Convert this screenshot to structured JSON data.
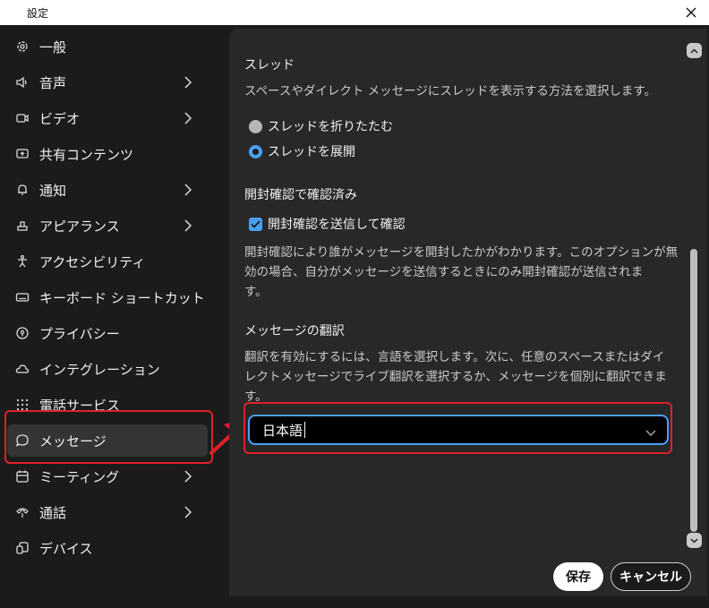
{
  "window": {
    "title": "設定"
  },
  "sidebar": {
    "items": [
      {
        "label": "一般",
        "icon": "gear-icon",
        "has_submenu": false
      },
      {
        "label": "音声",
        "icon": "speaker-icon",
        "has_submenu": true
      },
      {
        "label": "ビデオ",
        "icon": "video-camera-icon",
        "has_submenu": true
      },
      {
        "label": "共有コンテンツ",
        "icon": "screen-share-icon",
        "has_submenu": false
      },
      {
        "label": "通知",
        "icon": "bell-icon",
        "has_submenu": true
      },
      {
        "label": "アピアランス",
        "icon": "paint-brush-icon",
        "has_submenu": true
      },
      {
        "label": "アクセシビリティ",
        "icon": "accessibility-icon",
        "has_submenu": false
      },
      {
        "label": "キーボード ショートカット",
        "icon": "keyboard-icon",
        "has_submenu": false
      },
      {
        "label": "プライバシー",
        "icon": "privacy-icon",
        "has_submenu": false
      },
      {
        "label": "インテグレーション",
        "icon": "cloud-icon",
        "has_submenu": false
      },
      {
        "label": "電話サービス",
        "icon": "dialpad-icon",
        "has_submenu": false
      },
      {
        "label": "メッセージ",
        "icon": "chat-bubble-icon",
        "has_submenu": false,
        "active": true
      },
      {
        "label": "ミーティング",
        "icon": "calendar-icon",
        "has_submenu": true
      },
      {
        "label": "通話",
        "icon": "phone-icon",
        "has_submenu": true
      },
      {
        "label": "デバイス",
        "icon": "devices-icon",
        "has_submenu": false
      }
    ]
  },
  "content": {
    "threads": {
      "title": "スレッド",
      "description": "スペースやダイレクト メッセージにスレッドを表示する方法を選択します。",
      "options": [
        {
          "label": "スレッドを折りたたむ",
          "selected": false
        },
        {
          "label": "スレッドを展開",
          "selected": true
        }
      ]
    },
    "read_receipts": {
      "title": "開封確認で確認済み",
      "checkbox_label": "開封確認を送信して確認",
      "checked": true,
      "description_lines": [
        "開封確認により誰がメッセージを開封したかがわかります。このオプションが無",
        "効の場合、自分がメッセージを送信するときにのみ開封確認が送信されま",
        "す。"
      ]
    },
    "translation": {
      "title": "メッセージの翻訳",
      "description_lines": [
        "翻訳を有効にするには、言語を選択します。次に、任意のスペースまたはダイ",
        "レクトメッセージでライブ翻訳を選択するか、メッセージを個別に翻訳できま",
        "す。"
      ],
      "language_value": "日本語"
    }
  },
  "footer": {
    "save_label": "保存",
    "cancel_label": "キャンセル"
  },
  "colors": {
    "accent": "#4aa1f3",
    "highlight": "#e0202a"
  }
}
